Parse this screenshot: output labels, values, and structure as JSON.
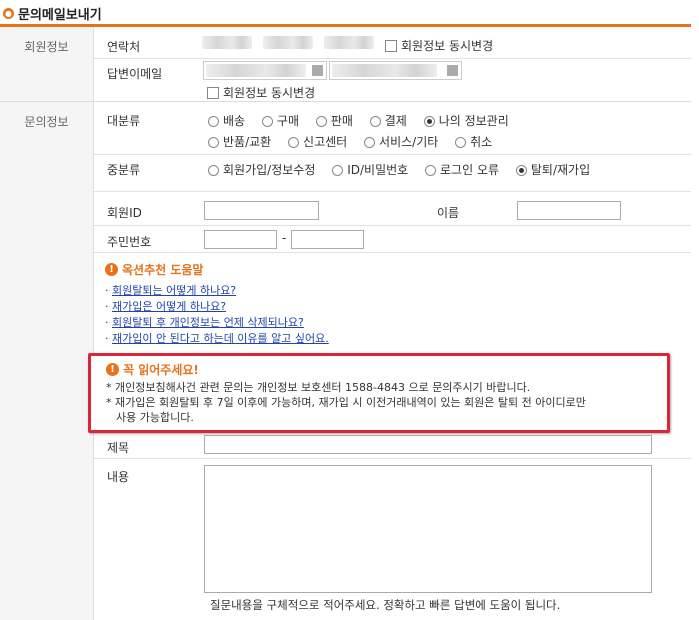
{
  "page": {
    "title": "문의메일보내기"
  },
  "member_info": {
    "side_label": "회원정보",
    "contact_label": "연락처",
    "contact_sync_label": "회원정보 동시변경",
    "email_label": "답변이메일",
    "email_sync_label": "회원정보 동시변경"
  },
  "inquiry": {
    "side_label": "문의정보",
    "major_label": "대분류",
    "major_options": [
      "배송",
      "구매",
      "판매",
      "결제",
      "나의 정보관리",
      "반품/교환",
      "신고센터",
      "서비스/기타",
      "취소"
    ],
    "major_selected": "나의 정보관리",
    "minor_label": "중분류",
    "minor_options": [
      "회원가입/정보수정",
      "ID/비밀번호",
      "로그인 오류",
      "탈퇴/재가입"
    ],
    "minor_selected": "탈퇴/재가입",
    "member_id_label": "회원ID",
    "name_label": "이름",
    "rrn_label": "주민번호",
    "rrn_separator": "-"
  },
  "help": {
    "title": "옥션추천 도움말",
    "links": [
      "회원탈퇴는 어떻게 하나요?",
      "재가입은 어떻게 하나요?",
      "회원탈퇴 후 개인정보는 언제 삭제되나요?",
      "재가입이 안 된다고 하는데 이유를 알고 싶어요."
    ]
  },
  "notice": {
    "title": "꼭 읽어주세요!",
    "line1": "* 개인정보침해사건 관련 문의는 개인정보 보호센터 1588-4843 으로 문의주시기 바랍니다.",
    "line2a": "* 재가입은 회원탈퇴 후 7일 이후에 가능하며, 재가입 시 이전거래내역이 있는 회원은 탈퇴 전 아이디로만",
    "line2b": "사용 가능합니다."
  },
  "form": {
    "subject_label": "제목",
    "content_label": "내용",
    "content_hint": "질문내용을 구체적으로 적어주세요. 정확하고 빠른 답변에 도움이 됩니다."
  },
  "colors": {
    "accent": "#e8721c",
    "notice_border": "#d9263b",
    "link": "#2244aa"
  }
}
